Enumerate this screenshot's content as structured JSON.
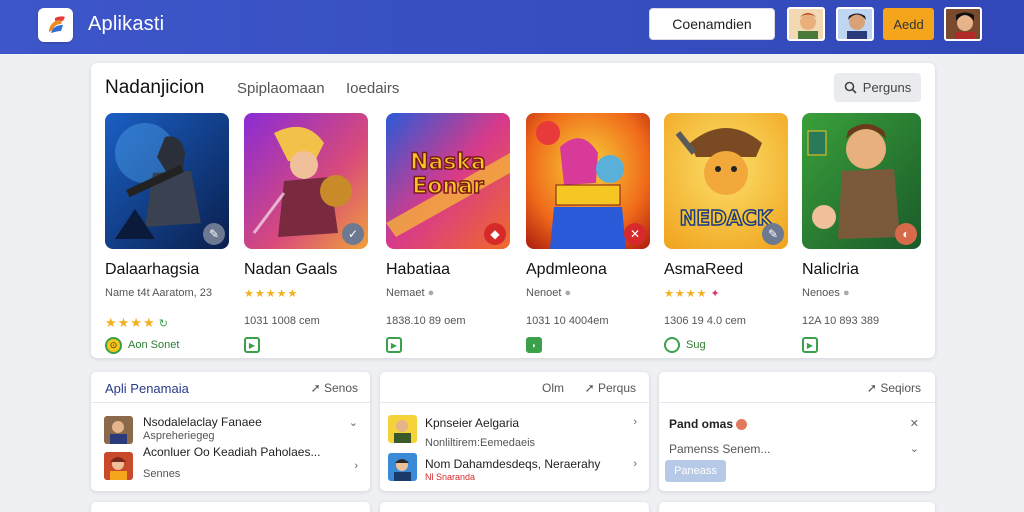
{
  "header": {
    "title": "Aplikasti",
    "action_button": "Coenamdien",
    "accent_button": "Aedd"
  },
  "main": {
    "title": "Nadanjicion",
    "tabs": [
      "Spiplaomaan",
      "Ioedairs"
    ],
    "search_label": "Perguns",
    "games": [
      {
        "name": "Dalaarhagsia",
        "meta": "Name t4t Aaratom, 23",
        "stats": "",
        "tag": "Aon Sonet"
      },
      {
        "name": "Nadan Gaals",
        "meta": "",
        "stats": "1031 1008 cem",
        "tag": ""
      },
      {
        "name": "Habatiaa",
        "meta": "Nemaet",
        "stats": "1838.10 89 oem",
        "tag": "",
        "art_text": "Naska Eonar"
      },
      {
        "name": "Apdmleona",
        "meta": "Nenoet",
        "stats": "1031 10 4004em",
        "tag": ""
      },
      {
        "name": "AsmaReed",
        "meta": "",
        "stats": "1306 19 4.0 cem",
        "tag": "Sug",
        "art_text": "NEDACK"
      },
      {
        "name": "Naliclria",
        "meta": "Nenoes",
        "stats": "12A 10 893 389",
        "tag": ""
      }
    ]
  },
  "panels": [
    {
      "title": "Apli Penamaia",
      "action": "Senos",
      "rows": [
        "Nsodalelaclay Fanaee",
        "Aspreheriegeg",
        "Aconluer Oo Keadiah Paholaes...",
        "Sennes"
      ]
    },
    {
      "title": "",
      "action_left": "Olm",
      "action": "Perqus",
      "rows": [
        "Kpnseier Aelgaria",
        "Nonliltirem:Eemedaeis",
        "Nom Dahamdesdeqs, Neraerahy",
        "Nl Snaranda"
      ]
    },
    {
      "title": "",
      "action": "Seqiors",
      "rows": [
        "Pand omas",
        "Pamenss Senem...",
        "Paneass"
      ]
    }
  ]
}
